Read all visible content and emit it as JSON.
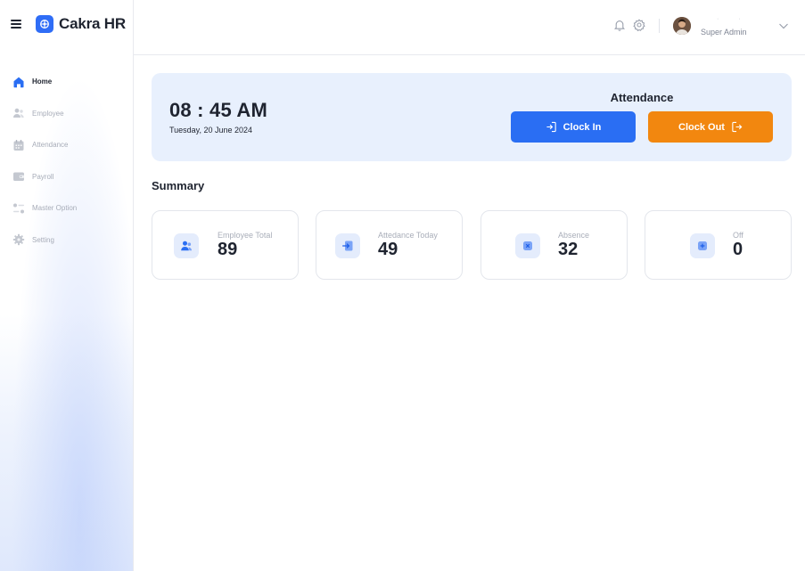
{
  "app": {
    "name": "Cakra HR",
    "accent": "#2f6df6"
  },
  "sidebar": {
    "items": [
      {
        "label": "Home",
        "icon": "home-icon",
        "active": true
      },
      {
        "label": "Employee",
        "icon": "users-icon",
        "active": false
      },
      {
        "label": "Attendance",
        "icon": "calendar-icon",
        "active": false
      },
      {
        "label": "Payroll",
        "icon": "wallet-icon",
        "active": false
      },
      {
        "label": "Master Option",
        "icon": "options-icon",
        "active": false
      },
      {
        "label": "Setting",
        "icon": "gear-icon",
        "active": false
      }
    ]
  },
  "header": {
    "user_role": "Super Admin",
    "icons": [
      "bell-icon",
      "settings-icon",
      "chevron-down-icon"
    ]
  },
  "attendance": {
    "time": "08 : 45 AM",
    "date": "Tuesday, 20 June 2024",
    "title": "Attendance",
    "clock_in_label": "Clock In",
    "clock_out_label": "Clock Out",
    "clock_in_color": "#2a6ef3",
    "clock_out_color": "#f2870f"
  },
  "summary": {
    "title": "Summary",
    "cards": [
      {
        "label": "Employee Total",
        "value": "89",
        "icon": "users-icon"
      },
      {
        "label": "Attedance Today",
        "value": "49",
        "icon": "login-icon"
      },
      {
        "label": "Absence",
        "value": "32",
        "icon": "x-icon"
      },
      {
        "label": "Off",
        "value": "0",
        "icon": "plus-icon"
      }
    ]
  }
}
